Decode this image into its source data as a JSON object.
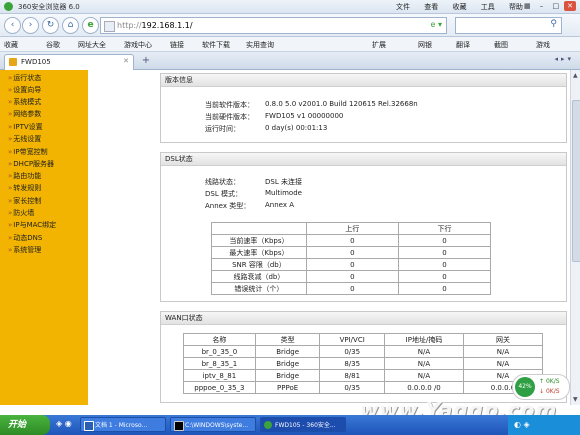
{
  "window": {
    "title": "360安全浏览器 6.0",
    "menus": [
      "文件",
      "查看",
      "收藏",
      "工具",
      "帮助"
    ]
  },
  "nav": {
    "url_prefix": "http://",
    "url_host": "192.168.1.1/",
    "search_value": ""
  },
  "favbar": {
    "items": [
      "收藏",
      "谷歌",
      "网址大全",
      "游戏中心",
      "链接",
      "软件下载",
      "实用查询"
    ],
    "right_items": [
      "扩展",
      "网银",
      "翻译",
      "截图",
      "游戏"
    ]
  },
  "tab": {
    "title": "FWD105"
  },
  "sidebar": {
    "items": [
      "运行状态",
      "设置向导",
      "系统模式",
      "网络参数",
      "IPTV设置",
      "无线设置",
      "IP带宽控制",
      "DHCP服务器",
      "路由功能",
      "转发规则",
      "家长控制",
      "防火墙",
      "IP与MAC绑定",
      "动态DNS",
      "系统管理"
    ]
  },
  "version_panel": {
    "title": "版本信息",
    "rows": [
      {
        "label": "当前软件版本：",
        "value": "0.8.0 5.0 v2001.0 Build 120615 Rel.32668n"
      },
      {
        "label": "当前硬件版本：",
        "value": "FWD105 v1 00000000"
      },
      {
        "label": "运行时间：",
        "value": "0 day(s) 00:01:13"
      }
    ]
  },
  "dsl_panel": {
    "title": "DSL状态",
    "rows": [
      {
        "label": "线路状态：",
        "value": "DSL 未连接"
      },
      {
        "label": "DSL 模式：",
        "value": "Multimode"
      },
      {
        "label": "Annex 类型：",
        "value": "Annex A"
      }
    ],
    "table_headers": [
      "",
      "上行",
      "下行"
    ],
    "table_rows": [
      [
        "当前速率（Kbps）",
        "0",
        "0"
      ],
      [
        "最大速率（Kbps）",
        "0",
        "0"
      ],
      [
        "SNR 容限（db）",
        "0",
        "0"
      ],
      [
        "线路衰减（db）",
        "0",
        "0"
      ],
      [
        "错误统计（个）",
        "0",
        "0"
      ]
    ]
  },
  "wan_panel": {
    "title": "WAN口状态",
    "table_headers": [
      "名称",
      "类型",
      "VPI/VCI",
      "IP地址/掩码",
      "网关"
    ],
    "table_rows": [
      [
        "br_0_35_0",
        "Bridge",
        "0/35",
        "N/A",
        "N/A"
      ],
      [
        "br_8_35_1",
        "Bridge",
        "8/35",
        "N/A",
        "N/A"
      ],
      [
        "iptv_8_81",
        "Bridge",
        "8/81",
        "N/A",
        "N/A"
      ],
      [
        "pppoe_0_35_3",
        "PPPoE",
        "0/35",
        "0.0.0.0 /0",
        "0.0.0.0"
      ]
    ]
  },
  "net_widget": {
    "percent": "42%",
    "up": "0K/S",
    "down": "0K/S"
  },
  "taskbar": {
    "start": "开始",
    "tasks": [
      "文档 1 - Microso...",
      "C:\\WINDOWS\\syste...",
      "FWD105 - 360安全..."
    ]
  },
  "watermark": "www.Yaqqp.com",
  "colors": {
    "sidebar": "#f2b400",
    "taskbar": "#2b66c9"
  }
}
